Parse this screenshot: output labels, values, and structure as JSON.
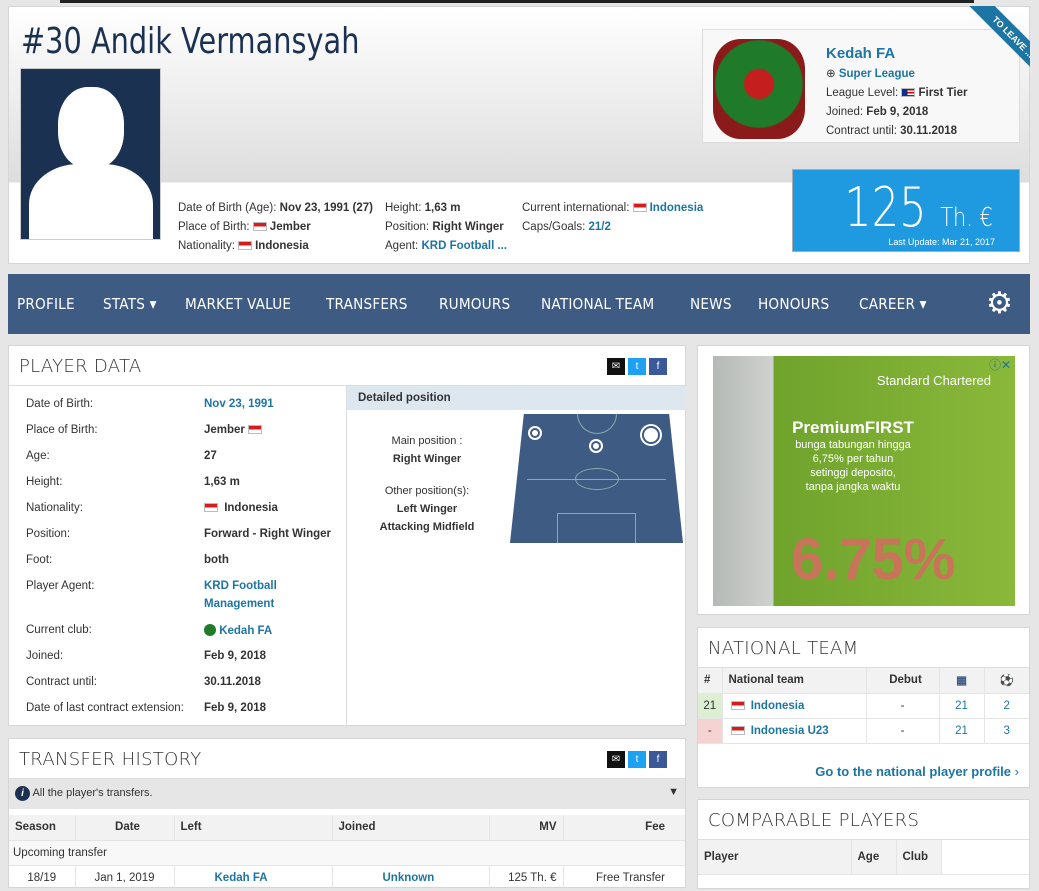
{
  "player": {
    "number": "#30",
    "first": "Andik",
    "last": "Vermansyah"
  },
  "info": {
    "dob_label": "Date of Birth (Age):",
    "dob": "Nov 23, 1991 (27)",
    "pob_label": "Place of Birth:",
    "pob": "Jember",
    "nat_label": "Nationality:",
    "nat": "Indonesia",
    "height_label": "Height:",
    "height": "1,63 m",
    "pos_label": "Position:",
    "pos": "Right Winger",
    "agent_label": "Agent:",
    "agent": "KRD Football ...",
    "intl_label": "Current international:",
    "intl": "Indonesia",
    "caps_label": "Caps/Goals:",
    "caps": "21/2"
  },
  "club": {
    "name": "Kedah FA",
    "league": "Super League",
    "level_label": "League Level:",
    "level": "First Tier",
    "joined_label": "Joined:",
    "joined": "Feb 9, 2018",
    "contract_label": "Contract until:",
    "contract": "30.11.2018",
    "ribbon": "TO LEAVE ..."
  },
  "market_value": {
    "value": "125",
    "unit": "Th. €",
    "update": "Last Update: Mar 21, 2017"
  },
  "nav": [
    "PROFILE",
    "STATS ▾",
    "MARKET VALUE",
    "TRANSFERS",
    "RUMOURS",
    "NATIONAL TEAM",
    "NEWS",
    "HONOURS",
    "CAREER ▾"
  ],
  "player_data": {
    "title": "PLAYER DATA",
    "rows": [
      [
        "Date of Birth:",
        "Nov 23, 1991"
      ],
      [
        "Place of Birth:",
        "Jember"
      ],
      [
        "Age:",
        "27"
      ],
      [
        "Height:",
        "1,63 m"
      ],
      [
        "Nationality:",
        "Indonesia"
      ],
      [
        "Position:",
        "Forward - Right Winger"
      ],
      [
        "Foot:",
        "both"
      ],
      [
        "Player Agent:",
        "KRD Football"
      ],
      [
        "",
        "Management"
      ],
      [
        "Current club:",
        "Kedah FA"
      ],
      [
        "Joined:",
        "Feb 9, 2018"
      ],
      [
        "Contract until:",
        "30.11.2018"
      ],
      [
        "Date of last contract extension:",
        "Feb 9, 2018"
      ]
    ],
    "detailed_title": "Detailed position",
    "main_label": "Main position :",
    "main": "Right Winger",
    "other_label": "Other position(s):",
    "other1": "Left Winger",
    "other2": "Attacking Midfield"
  },
  "ad": {
    "brand": "Standard Chartered",
    "headline": "PremiumFIRST",
    "l1": "bunga tabungan hingga",
    "l2": "6,75% per tahun",
    "l3": "setinggi deposito,",
    "l4": "tanpa jangka waktu",
    "big": "6.75%"
  },
  "national": {
    "title": "NATIONAL TEAM",
    "headers": [
      "#",
      "National team",
      "Debut",
      "",
      ""
    ],
    "rows": [
      [
        "21",
        "Indonesia",
        "-",
        "21",
        "2"
      ],
      [
        "-",
        "Indonesia U23",
        "-",
        "21",
        "3"
      ]
    ],
    "link": "Go to the national player profile"
  },
  "transfers": {
    "title": "TRANSFER HISTORY",
    "info": "All the player's transfers.",
    "headers": [
      "Season",
      "Date",
      "Left",
      "Joined",
      "MV",
      "Fee"
    ],
    "upcoming": "Upcoming transfer",
    "row": [
      "18/19",
      "Jan 1, 2019",
      "Kedah FA",
      "Unknown",
      "125 Th. €",
      "Free Transfer"
    ]
  },
  "comparable": {
    "title": "COMPARABLE PLAYERS",
    "headers": [
      "Player",
      "Age",
      "Club"
    ]
  }
}
